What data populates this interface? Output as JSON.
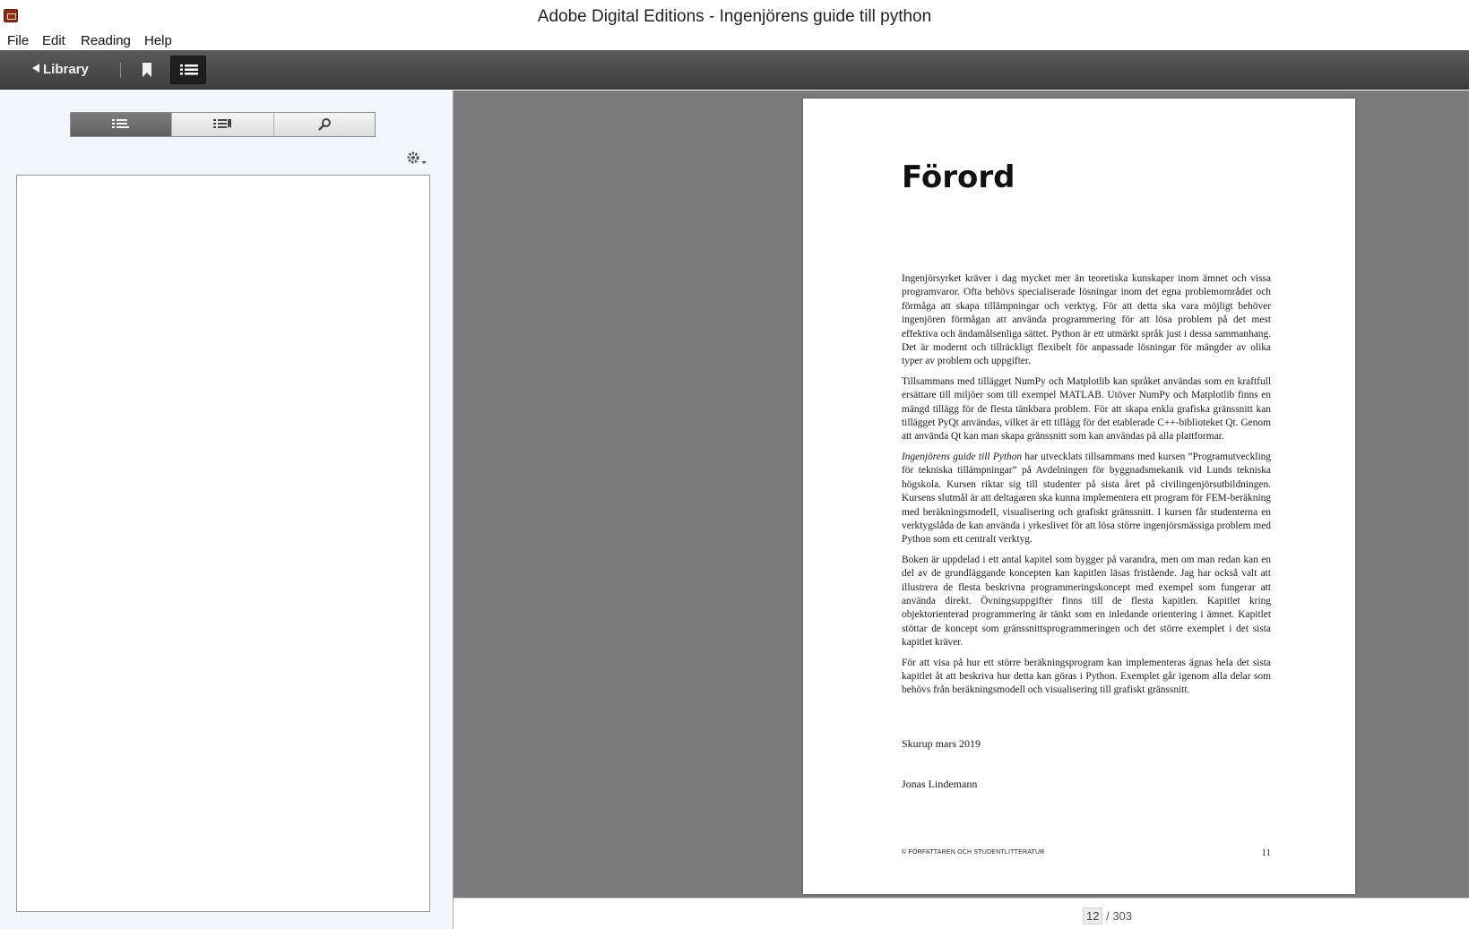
{
  "window": {
    "title": "Adobe Digital Editions - Ingenjörens guide till python"
  },
  "menu": {
    "items": [
      "File",
      "Edit",
      "Reading",
      "Help"
    ]
  },
  "toolbar": {
    "library_label": "Library",
    "icons": [
      "bookmark-icon",
      "table-of-contents-icon"
    ]
  },
  "panel": {
    "tabs": [
      "toc-icon",
      "bookmarks-icon",
      "search-icon"
    ],
    "active_tab": 0
  },
  "book_page": {
    "heading": "Förord",
    "paragraphs": [
      "Ingenjörsyrket kräver i dag mycket mer än teoretiska kunskaper inom ämnet och vissa programvaror. Ofta behövs specialiserade lösningar inom det egna problemområdet och förmåga att skapa tillämpningar och verktyg. För att detta ska vara möjligt behöver ingenjören förmågan att använda programmering för att lösa problem på det mest effektiva och ändamålsenliga sättet. Python är ett utmärkt språk just i dessa sammanhang. Det är modernt och tillräckligt flexibelt för anpassade lösningar för mängder av olika typer av problem och uppgifter.",
      "Tillsammans med tillägget NumPy och Matplotlib kan språket användas som en kraftfull ersättare till miljöer som till exempel MATLAB. Utöver NumPy och Matplotlib finns en mängd tillägg för de flesta tänkbara problem. För att skapa enkla grafiska gränssnitt kan tillägget PyQt användas, vilket är ett tillägg för det etablerade C++-biblioteket Qt. Genom att använda Qt kan man skapa gränssnitt som kan användas på alla plattformar.",
      "har utvecklats tillsammans med kursen ”Programutveckling för tekniska tillämpningar” på Avdelningen för byggnadsmekanik vid Lunds tekniska högskola. Kursen riktar sig till studenter på sista året på civilingenjörsutbildningen. Kursens slutmål är att deltagaren ska kunna implementera ett program för FEM-beräkning med beräkningsmodell, visualisering och grafiskt gränssnitt. I kursen får studenterna en verktygslåda de kan använda i yrkeslivet för att lösa större ingenjörsmässiga problem med Python som ett centralt verktyg.",
      "Boken är uppdelad i ett antal kapitel som bygger på varandra, men om man redan kan en del av de grundläggande koncepten kan kapitlen läsas fristående. Jag har också valt att illustrera de flesta beskrivna programmeringskoncept med exempel som fungerar att använda direkt. Övningsuppgifter finns till de flesta kapitlen. Kapitlet kring objektorienterad programmering är tänkt som en inledande orientering i ämnet. Kapitlet stöttar de koncept som gränssnittsprogrammeringen och det större exemplet i det sista kapitlet kräver.",
      "För att visa på hur ett större beräkningsprogram kan implementeras ägnas hela det sista kapitlet åt att beskriva hur detta kan göras i Python. Exemplet går igenom alla delar som behövs från beräkningsmodell och visualisering till grafiskt gränssnitt."
    ],
    "italic_title": "Ingenjörens guide till Python",
    "place_date": "Skurup mars 2019",
    "author": "Jonas Lindemann",
    "footer_left": "© FÖRFATTAREN OCH STUDENTLITTERATUR",
    "footer_right": "11"
  },
  "status": {
    "current_page": "12",
    "total_pages": "/ 303"
  }
}
